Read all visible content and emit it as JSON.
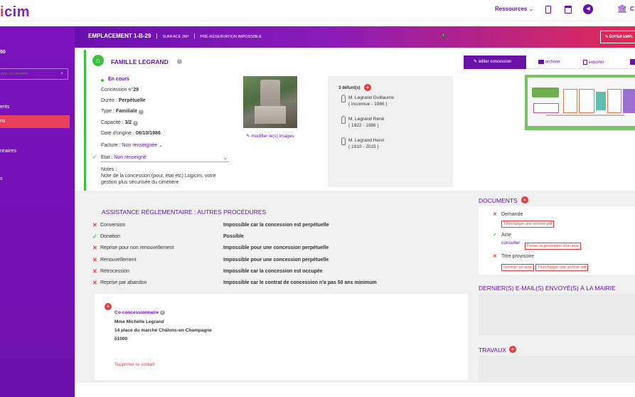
{
  "app": {
    "logo": "gicim"
  },
  "topnav": {
    "resources": "Ressources",
    "user_initial": "C"
  },
  "sidebar": {
    "number": "50",
    "search_placeholder": "pour ce cimetière",
    "items": [
      {
        "label": "ents",
        "active": false
      },
      {
        "label": "ns",
        "active": true
      },
      {
        "label": "nnaires",
        "active": false
      },
      {
        "label": "s",
        "active": false
      }
    ]
  },
  "banner": {
    "location": "EMPLACEMENT 1-B-29",
    "surface": "SURFACE 2M²",
    "prereservation": "PRÉ-RÉSERVATION IMPOSSIBLE",
    "edit_button": "ÉDITER EMPL"
  },
  "family": {
    "title": "FAMILLE LEGRAND",
    "status": "En cours",
    "concession_label": "Concession n°",
    "concession_value": "29",
    "duree_label": "Durée : ",
    "duree_value": "Perpétuelle",
    "type_label": "Type : ",
    "type_value": "Familiale",
    "capacite_label": "Capacité : ",
    "capacite_value": "3/2",
    "date_label": "Date d'origine : ",
    "date_value": "06/10/1986",
    "facture_label": "Facture :",
    "facture_value": "Non renseignée",
    "etat_label": "Etat :",
    "etat_value": "Non renseigné",
    "notes_label": "Notes :",
    "notes_text": "Note de la concession (pour, état etc) Logicim, votre gestion plus sécurisée du cimetière",
    "modify_images": "modifier le(s) images"
  },
  "defunts": {
    "title": "3 défunt(s)",
    "list": [
      {
        "name": "M. Legrand Guillaume",
        "dates": "( inconnue - 1986 )"
      },
      {
        "name": "M. Legrand René",
        "dates": "( 1922 - 1986 )"
      },
      {
        "name": "M. Legrand Henri",
        "dates": "( 1910 - 2015 )"
      }
    ]
  },
  "actions": {
    "edit": "éditer concession",
    "archive": "archiver",
    "export": "exporter"
  },
  "assistance": {
    "title": "ASSISTANCE RÉGLEMENTAIRE : AUTRES PROCÉDURES",
    "rows": [
      {
        "ok": false,
        "label": "Conversion",
        "value": "Impossible car la concession est perpétuelle"
      },
      {
        "ok": true,
        "label": "Donation",
        "value": "Possible"
      },
      {
        "ok": false,
        "label": "Reprise pour non renouvellement",
        "value": "Impossible pour une concession perpétuelle"
      },
      {
        "ok": false,
        "label": "Renouvellement",
        "value": "Impossible pour une concession perpétuelle"
      },
      {
        "ok": false,
        "label": "Rétrocession",
        "value": "Impossible car la concession est occupée"
      },
      {
        "ok": false,
        "label": "Reprise par abandon",
        "value": "Impossible car le contrat de concession n'a pas 50 ans minimum"
      }
    ]
  },
  "contact": {
    "role": "Co-concessionnaire",
    "name": "Mme Michèlle Legrand",
    "address": "14 place du marché Châlons-en-Champagne",
    "zip": "51000",
    "delete": "Supprimer ce contact"
  },
  "documents": {
    "title": "DOCUMENTS",
    "items": [
      {
        "ok": false,
        "label": "Demande",
        "links": [
          "Télécharger une archive pdf"
        ],
        "consult": ""
      },
      {
        "ok": true,
        "label": "Acte",
        "links": [
          "Forcer la génération d'un acte"
        ],
        "consult": "consulter"
      },
      {
        "ok": false,
        "label": "Titre provisoire",
        "links": [
          "Générer un acte",
          "Télécharger une archive pdf"
        ],
        "consult": ""
      }
    ]
  },
  "emails": {
    "title": "DERNIER(S) E-MAIL(S) ENVOYÉ(S) À LA MAIRIE"
  },
  "travaux": {
    "title": "TRAVAUX"
  },
  "colors": {
    "purple": "#6a10a8",
    "red": "#e43a3a",
    "green": "#3cbf3c"
  }
}
